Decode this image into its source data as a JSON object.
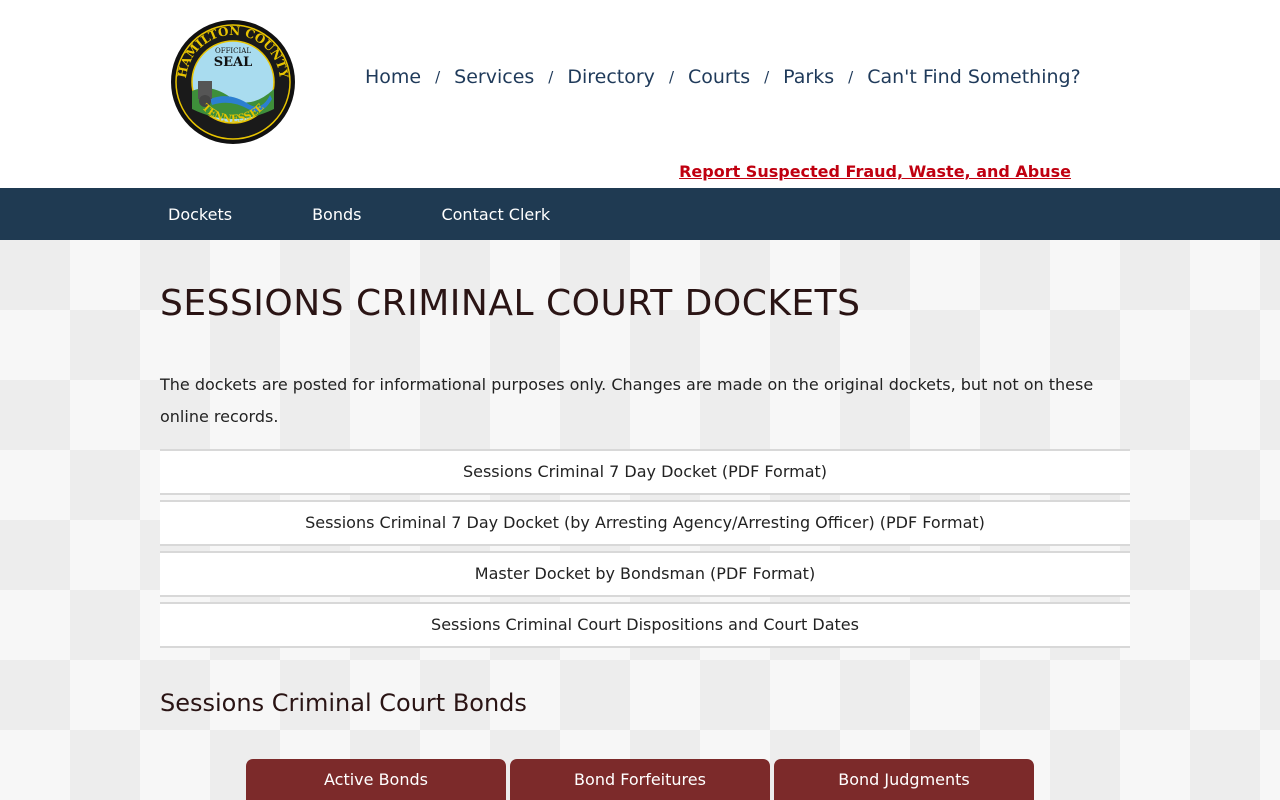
{
  "header": {
    "seal": {
      "top_text": "HAMILTON COUNTY",
      "bottom_text": "TENNESSEE",
      "official": "OFFICIAL",
      "seal": "SEAL"
    },
    "topnav": [
      "Home",
      "Services",
      "Directory",
      "Courts",
      "Parks",
      "Can't Find Something?"
    ],
    "separator": "/",
    "report_link": "Report Suspected Fraud, Waste, and Abuse"
  },
  "subnav": [
    "Dockets",
    "Bonds",
    "Contact Clerk"
  ],
  "main": {
    "title": "SESSIONS CRIMINAL COURT DOCKETS",
    "intro": "The dockets are posted for informational purposes only. Changes are made on the original dockets, but not on these online records.",
    "dockets": [
      "Sessions Criminal 7 Day Docket (PDF Format)",
      "Sessions Criminal 7 Day Docket (by Arresting Agency/Arresting Officer) (PDF Format)",
      "Master Docket by Bondsman (PDF Format)",
      "Sessions Criminal Court Dispositions and Court Dates"
    ],
    "bonds_heading": "Sessions Criminal Court Bonds",
    "bond_buttons": [
      "Active Bonds",
      "Bond Forfeitures",
      "Bond Judgments"
    ]
  },
  "colors": {
    "navy": "#1f3a52",
    "report_red": "#c00010",
    "bond_button": "#7c2a2a"
  }
}
